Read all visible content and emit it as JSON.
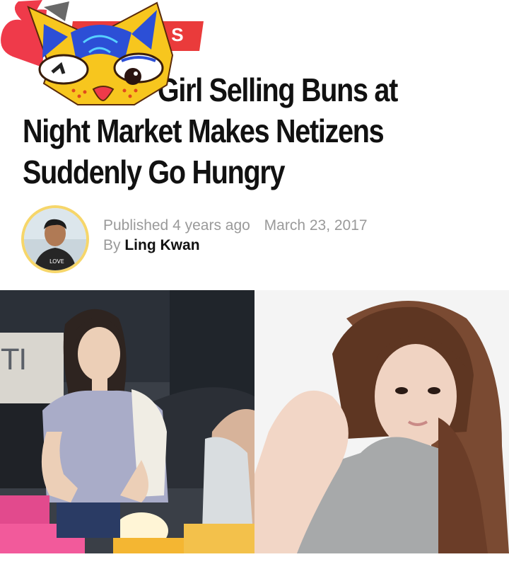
{
  "article": {
    "category_label": "S",
    "title": "Girl Selling Buns at Night Market Makes Netizens Suddenly Go Hungry",
    "title_lines": [
      "Girl Selling Buns at",
      "Night Market Makes Netizens",
      "Suddenly Go Hungry"
    ]
  },
  "meta": {
    "published_prefix": "Published",
    "relative_time": "4 years ago",
    "date": "March 23, 2017",
    "by_prefix": "By",
    "author": "Ling Kwan"
  },
  "avatar": {
    "icon": "author-avatar",
    "ring_color": "#f6d66a",
    "shirt_text": "LOVE"
  },
  "sticker": {
    "icon": "cat-mask-sticker",
    "colors": {
      "yellow": "#f7c61e",
      "blue": "#2c4fd6",
      "pink": "#ef3a4a"
    }
  },
  "photos": [
    {
      "icon": "night-market-girl-photo",
      "sign_text": "TI"
    },
    {
      "icon": "girl-portrait-photo"
    }
  ]
}
